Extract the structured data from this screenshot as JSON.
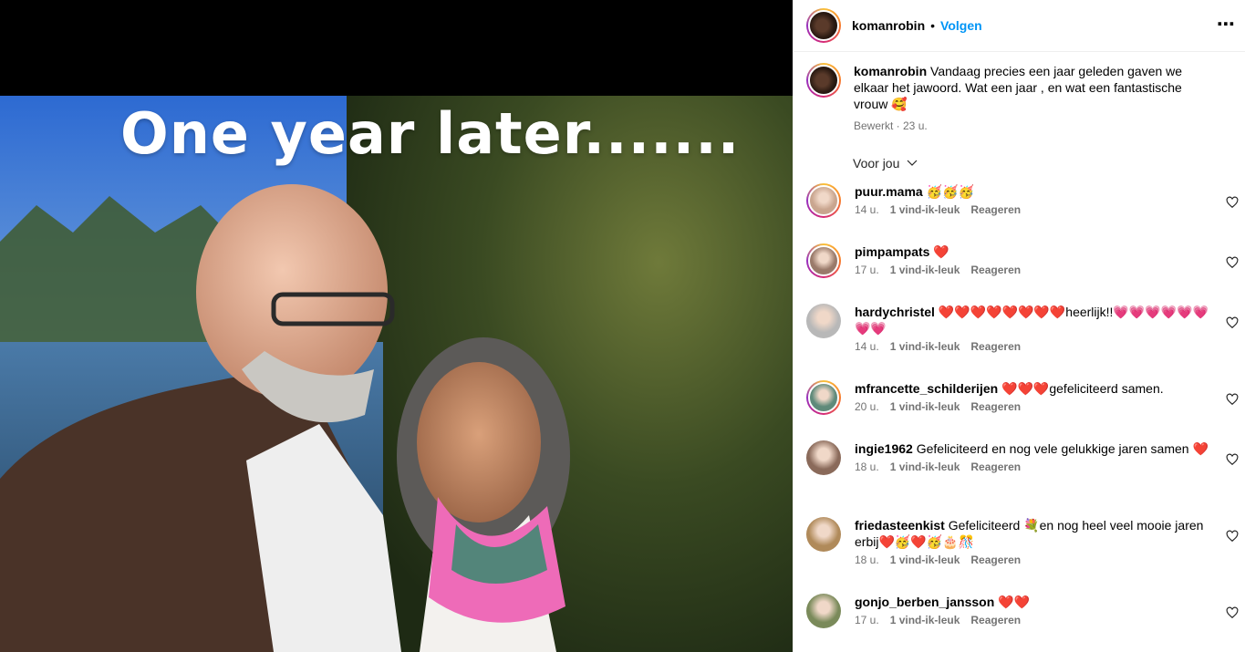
{
  "post": {
    "username": "komanrobin",
    "separator": "•",
    "follow_label": "Volgen",
    "more_icon": "⋯",
    "overlay_text": "One year later.......",
    "caption_user": "komanrobin",
    "caption_text": "Vandaag precies een jaar geleden gaven we elkaar het jawoord. Wat een jaar , en wat een fantastische vrouw 🥰",
    "caption_meta": "Bewerkt · 23 u.",
    "sort_label": "Voor jou",
    "sort_icon": "chevron-down-icon"
  },
  "comments": [
    {
      "user": "puur.mama",
      "text": "🥳🥳🥳",
      "time": "14 u.",
      "likes": "1 vind-ik-leuk",
      "reply": "Reageren",
      "avatar_color": "#c9a58f",
      "ring": true
    },
    {
      "user": "pimpampats",
      "text": "❤️",
      "time": "17 u.",
      "likes": "1 vind-ik-leuk",
      "reply": "Reageren",
      "avatar_color": "#9a7a6a",
      "ring": true
    },
    {
      "user": "hardychristel",
      "text": "❤️❤️❤️❤️❤️❤️❤️❤️heerlijk!!💗💗💗💗💗💗💗💗",
      "time": "14 u.",
      "likes": "1 vind-ik-leuk",
      "reply": "Reageren",
      "avatar_color": "#b8b8b8",
      "ring": false
    },
    {
      "user": "mfrancette_schilderijen",
      "text": "❤️❤️❤️gefeliciteerd samen.",
      "time": "20 u.",
      "likes": "1 vind-ik-leuk",
      "reply": "Reageren",
      "avatar_color": "#5f8a7a",
      "ring": true
    },
    {
      "user": "ingie1962",
      "text": "Gefeliciteerd en nog vele gelukkige jaren samen ❤️",
      "time": "18 u.",
      "likes": "1 vind-ik-leuk",
      "reply": "Reageren",
      "avatar_color": "#8a6a5a",
      "ring": false
    },
    {
      "user": "friedasteenkist",
      "text": "Gefeliciteerd 💐en nog heel veel mooie jaren erbij❤️🥳❤️🥳🎂🎊",
      "time": "18 u.",
      "likes": "1 vind-ik-leuk",
      "reply": "Reageren",
      "avatar_color": "#b08a5a",
      "ring": false
    },
    {
      "user": "gonjo_berben_jansson",
      "text": "❤️❤️",
      "time": "17 u.",
      "likes": "1 vind-ik-leuk",
      "reply": "Reageren",
      "avatar_color": "#7a8a5a",
      "ring": false
    }
  ],
  "colors": {
    "accent": "#0095f6",
    "meta": "#737373"
  }
}
